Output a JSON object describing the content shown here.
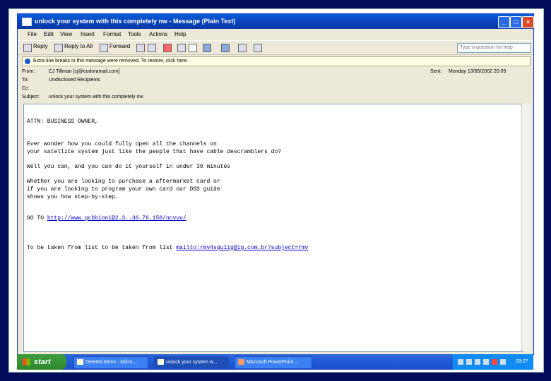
{
  "window": {
    "title": "unlock your system with this completely nw - Message (Plain Text)",
    "controls": {
      "minimize": "_",
      "maximize": "□",
      "close": "×"
    }
  },
  "menu": {
    "items": [
      "File",
      "Edit",
      "View",
      "Insert",
      "Format",
      "Tools",
      "Actions",
      "Help"
    ],
    "help_placeholder": "Type a question for help"
  },
  "toolbar": {
    "reply": "Reply",
    "reply_all": "Reply to All",
    "forward": "Forward"
  },
  "infobar": {
    "text": "Extra line breaks in this message were removed. To restore, click here."
  },
  "header": {
    "from_label": "From:",
    "from_value": "CJ Tillman [cj@eudoramail.com]",
    "to_label": "To:",
    "to_value": "Undisclosed Recipients",
    "cc_label": "Cc:",
    "cc_value": "",
    "subject_label": "Subject:",
    "subject_value": "unlock your system with this completely nw",
    "sent_label": "Sent:",
    "sent_value": "Monday 13/05/2002 20:05"
  },
  "message": {
    "greeting": "ATTN: BUSINESS OWNER,",
    "p1_l1": "Ever wonder how you could fully open all the channels on",
    "p1_l2": "your satellite system just like the people that have cable descramblers do?",
    "p2": "Well you can, and you can do it yourself in under 30 minutes",
    "p3_l1": "Whether you are looking to purchase a aftermarket card or",
    "p3_l2": "if you are looking to program your own card our DSS guide",
    "p3_l3": "shows you how step-by-step.",
    "goto_label": "GO TO ",
    "goto_link": "http://www.gcbbioni@2.3..36.76.150/ncvuv/",
    "remove_text": "To be taken from list to be taken from list ",
    "remove_link": "mailto:rmv4sgu1ig@ig.com.br?subject=rmv"
  },
  "taskbar": {
    "start": "start",
    "tasks": [
      "Deleted Items - Micro...",
      "unlock your system w...",
      "Microsoft PowerPoint ..."
    ],
    "clock": "09:27"
  }
}
